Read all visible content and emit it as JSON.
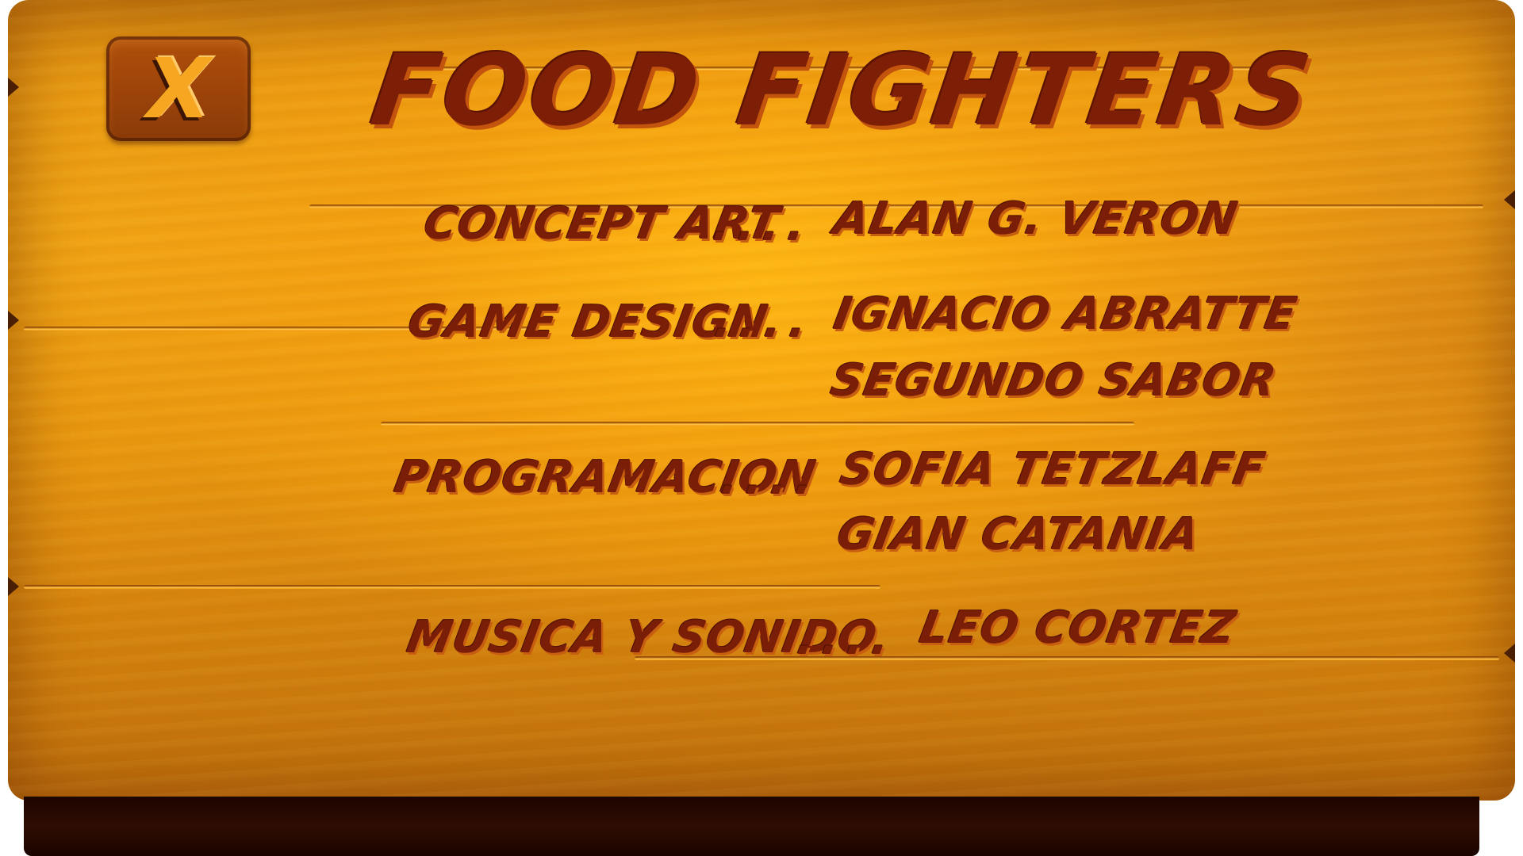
{
  "game": {
    "title": "FOOD FIGHTERS",
    "close_button_label": "X"
  },
  "credits": [
    {
      "role": "CONCEPT ART",
      "separator": "....",
      "names": [
        "ALAN G. VERON"
      ]
    },
    {
      "role": "GAME DESIGN",
      "separator": "....",
      "names": [
        "IGNACIO ABRATTE",
        "SEGUNDO SABOR"
      ]
    },
    {
      "role": "PROGRAMACION",
      "separator": "....",
      "names": [
        "SOFIA TETZLAFF",
        "GIAN CATANIA"
      ]
    },
    {
      "role": "MUSICA Y SONIDO",
      "separator": "....",
      "names": [
        "LEO CORTEZ"
      ]
    }
  ],
  "colors": {
    "board_wood": "#f0a313",
    "text_main": "#7a1e08",
    "text_shadow": "#c85f10",
    "close_button": "#9c430a",
    "bottom_bar": "#2e0d02"
  }
}
